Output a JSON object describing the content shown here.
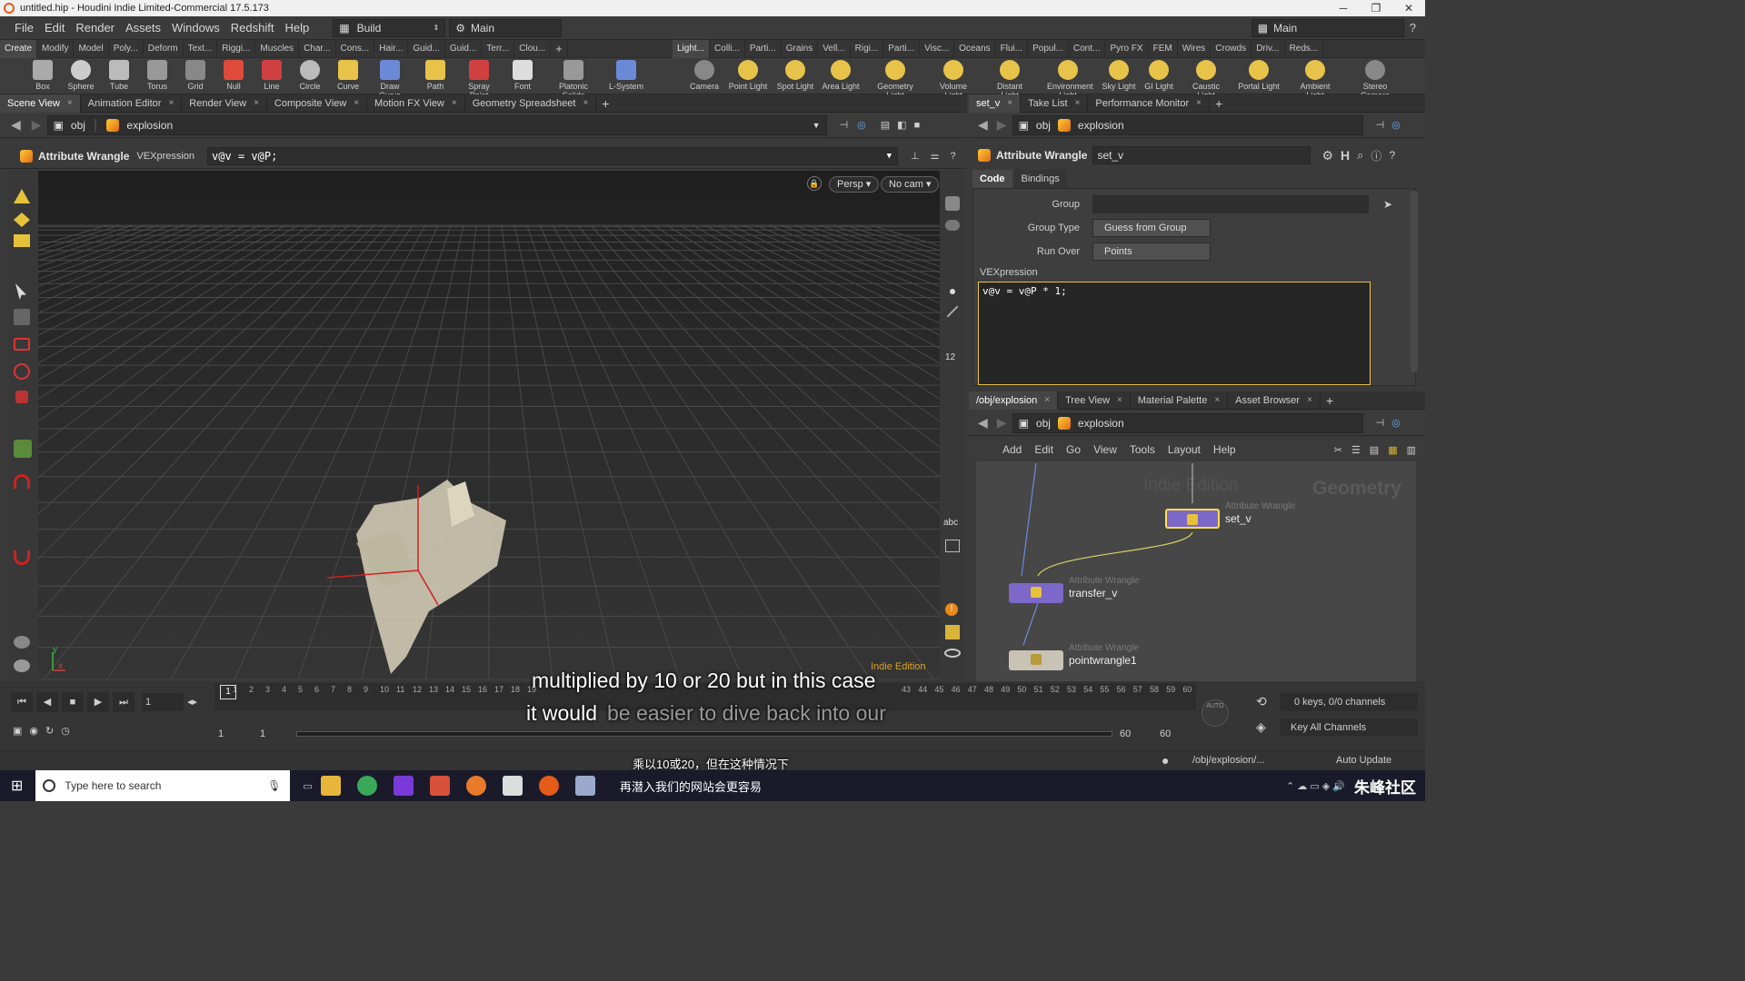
{
  "window": {
    "title": "untitled.hip - Houdini Indie Limited-Commercial 17.5.173"
  },
  "menubar": {
    "items": [
      "File",
      "Edit",
      "Render",
      "Assets",
      "Windows",
      "Redshift",
      "Help"
    ],
    "desktop": "Build",
    "desktop_right": "Main",
    "main_label": "Main"
  },
  "shelf_tabs_left": [
    "Create",
    "Modify",
    "Model",
    "Poly...",
    "Deform",
    "Text...",
    "Riggi...",
    "Muscles",
    "Char...",
    "Cons...",
    "Hair...",
    "Guid...",
    "Guid...",
    "Terr...",
    "Clou..."
  ],
  "shelf_tabs_right": [
    "Light...",
    "Colli...",
    "Parti...",
    "Grains",
    "Vell...",
    "Rigi...",
    "Parti...",
    "Visc...",
    "Oceans",
    "Flui...",
    "Popul...",
    "Cont...",
    "Pyro FX",
    "FEM",
    "Wires",
    "Crowds",
    "Driv...",
    "Reds..."
  ],
  "tools_left": [
    "Box",
    "Sphere",
    "Tube",
    "Torus",
    "Grid",
    "Null",
    "Line",
    "Circle",
    "Curve",
    "Draw Curve",
    "Path",
    "Spray Paint",
    "Font",
    "Platonic Solids",
    "L-System"
  ],
  "tools_right": [
    "Camera",
    "Point Light",
    "Spot Light",
    "Area Light",
    "Geometry Light",
    "Volume Light",
    "Distant Light",
    "Environment Light",
    "Sky Light",
    "GI Light",
    "Caustic Light",
    "Portal Light",
    "Ambient Light",
    "Stereo Camera"
  ],
  "left_tabs": [
    "Scene View",
    "Animation Editor",
    "Render View",
    "Composite View",
    "Motion FX View",
    "Geometry Spreadsheet"
  ],
  "path": {
    "root": "obj",
    "node": "explosion"
  },
  "op_toolbar": {
    "node_type": "Attribute Wrangle",
    "parm_label": "VEXpression",
    "parm_value": "v@v = v@P;"
  },
  "viewport": {
    "persp": "Persp ▾",
    "cam": "No cam ▾",
    "edition": "Indie Edition",
    "axis_y": "y",
    "axis_x": "x"
  },
  "right_tabs": [
    "set_v",
    "Take List",
    "Performance Monitor"
  ],
  "param": {
    "node_type": "Attribute Wrangle",
    "node_name": "set_v",
    "tabs": [
      "Code",
      "Bindings"
    ],
    "group_label": "Group",
    "group_value": "",
    "group_type_label": "Group Type",
    "group_type_value": "Guess from Group",
    "run_over_label": "Run Over",
    "run_over_value": "Points",
    "vex_label": "VEXpression",
    "vex_code": "v@v = v@P * 1;"
  },
  "net_tabs": [
    "/obj/explosion",
    "Tree View",
    "Material Palette",
    "Asset Browser"
  ],
  "net_menu": [
    "Add",
    "Edit",
    "Go",
    "View",
    "Tools",
    "Layout",
    "Help"
  ],
  "network": {
    "watermark_left": "Indie Edition",
    "watermark_right": "Geometry",
    "nodes": [
      {
        "type": "Attribute Wrangle",
        "name": "set_v"
      },
      {
        "type": "Attribute Wrangle",
        "name": "transfer_v"
      },
      {
        "type": "Attribute Wrangle",
        "name": "pointwrangle1"
      }
    ]
  },
  "timeline": {
    "frame": "1",
    "current": "1",
    "start": "1",
    "start2": "1",
    "end": "60",
    "end2": "60",
    "ticks": [
      "1",
      "2",
      "3",
      "4",
      "5",
      "6",
      "7",
      "8",
      "9",
      "10",
      "11",
      "12",
      "13",
      "14",
      "15",
      "16",
      "17",
      "18",
      "19",
      "43",
      "44",
      "45",
      "46",
      "47",
      "48",
      "49",
      "50",
      "51",
      "52",
      "53",
      "54",
      "55",
      "56",
      "57",
      "58",
      "59",
      "60"
    ],
    "keys_info": "0 keys, 0/0 channels",
    "key_all": "Key All Channels",
    "status_path": "/obj/explosion/...",
    "auto_update": "Auto Update",
    "auto_label": "AUTO"
  },
  "subtitles": {
    "en_line1": "multiplied by 10 or 20 but in this case",
    "en_line2_a": "it would",
    "en_line2_b": "be easier to dive back into our",
    "cn_line1": "乘以10或20，但在这种情况下",
    "cn_line2": "再潜入我们的网站会更容易"
  },
  "taskbar": {
    "search_placeholder": "Type here to search",
    "brand": "朱峰社区"
  },
  "colors": {
    "accent_orange": "#e45b1a",
    "node_purple": "#7b68c8",
    "node_selected": "#ffe14a",
    "vex_border": "#e8c34a"
  }
}
